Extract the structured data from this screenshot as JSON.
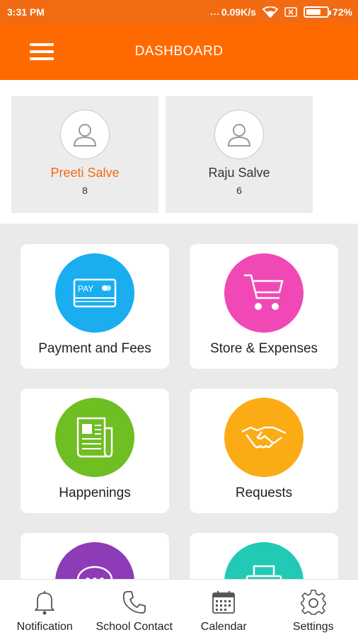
{
  "status_bar": {
    "time": "3:31 PM",
    "network_dots": "...",
    "speed": "0.09K/s",
    "battery": "72%",
    "battery_level": 0.72
  },
  "app_bar": {
    "title": "DASHBOARD"
  },
  "students": [
    {
      "name": "Preeti Salve",
      "number": "8",
      "selected": true
    },
    {
      "name": "Raju Salve",
      "number": "6",
      "selected": false
    }
  ],
  "tiles": [
    {
      "label": "Payment and Fees",
      "color": "#1aaef0",
      "icon": "payment-card-icon",
      "card_text": "PAY"
    },
    {
      "label": "Store & Expenses",
      "color": "#f049b5",
      "icon": "shopping-cart-icon"
    },
    {
      "label": "Happenings",
      "color": "#6fbe22",
      "icon": "newspaper-icon"
    },
    {
      "label": "Requests",
      "color": "#fbab14",
      "icon": "handshake-icon"
    },
    {
      "label": "",
      "color": "#8e3bb8",
      "icon": "chat-bubble-icon"
    },
    {
      "label": "",
      "color": "#22c9b5",
      "icon": "printer-icon"
    }
  ],
  "bottom_nav": [
    {
      "label": "Notification",
      "icon": "bell-icon"
    },
    {
      "label": "School Contact",
      "icon": "phone-icon"
    },
    {
      "label": "Calendar",
      "icon": "calendar-icon"
    },
    {
      "label": "Settings",
      "icon": "gear-icon"
    }
  ],
  "colors": {
    "primary": "#ff6a00",
    "status_bar": "#f26a12",
    "accent_text": "#f26a12"
  }
}
